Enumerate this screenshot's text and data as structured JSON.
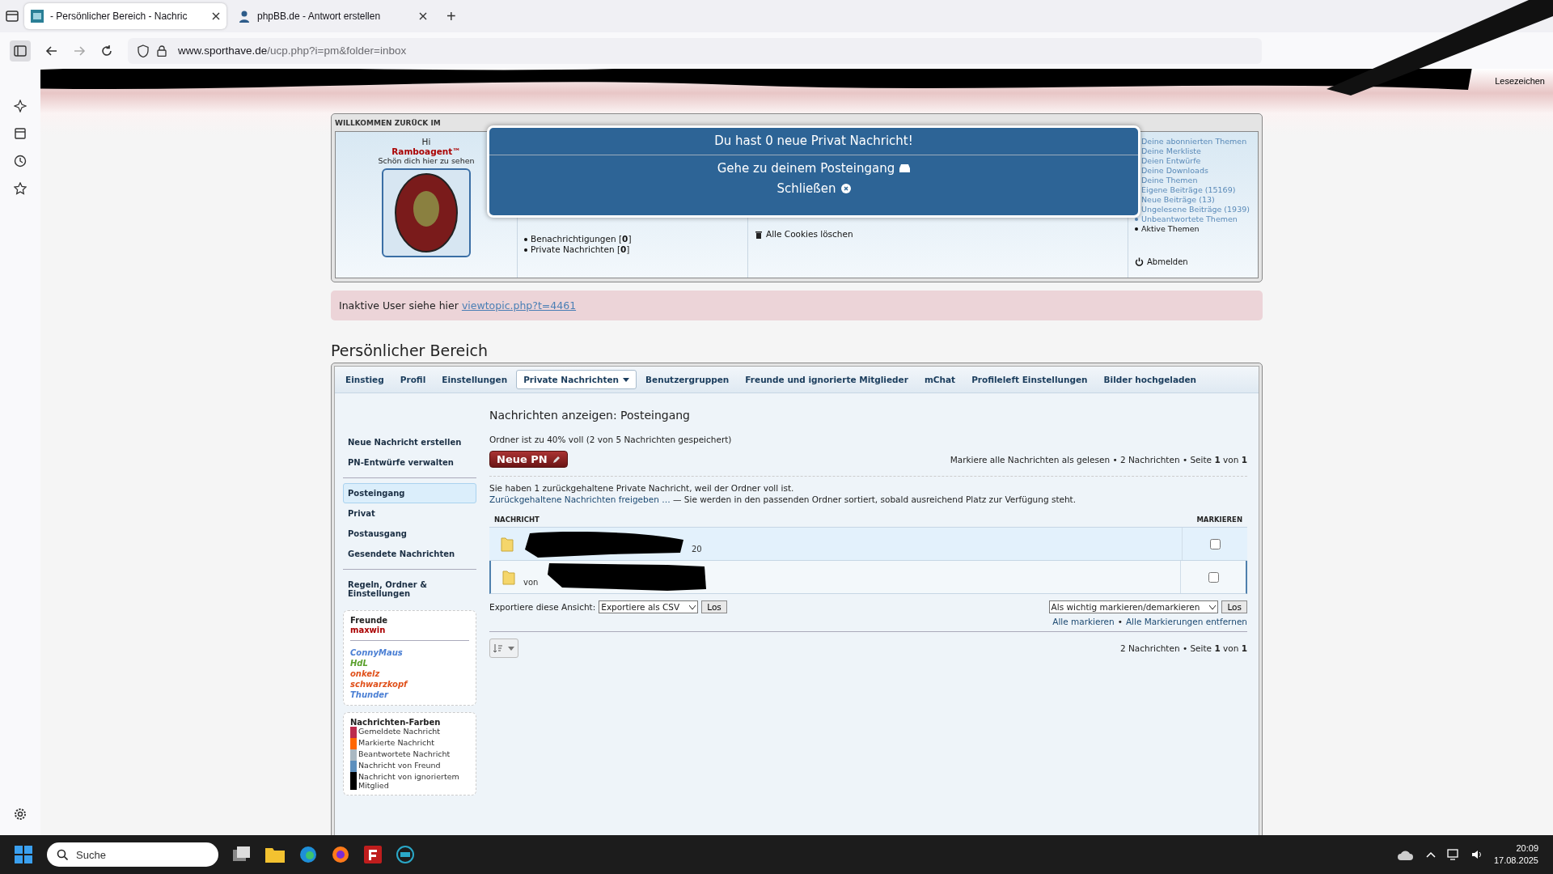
{
  "browser": {
    "tabs": [
      {
        "title": "- Persönlicher Bereich - Nachric",
        "selected": true
      },
      {
        "title": "phpBB.de - Antwort erstellen",
        "selected": false
      }
    ],
    "new_tab": "+",
    "url_host": "www.sporthave.de",
    "url_path": "/ucp.php?i=pm&folder=inbox",
    "bookmarks_label": "Lesezeichen"
  },
  "welcome": {
    "heading": "WILLKOMMEN ZURÜCK IM",
    "greeting": "Hi",
    "username": "Ramboagent™",
    "tagline": "Schön dich hier zu sehen",
    "counters": [
      "Benachrichtigungen [**0**]",
      "Private Nachrichten [**0**]"
    ],
    "cookies": "Alle Cookies löschen",
    "my_links": [
      "Deine abonnierten Themen",
      "Deine Merkliste",
      "Deien Entwürfe",
      "Deine Downloads",
      "Deine Themen",
      "Eigene Beiträge (15169)",
      "Neue Beiträge (13)",
      "Ungelesene Beiträge (1939)",
      "Unbeantwortete Themen",
      "Aktive Themen"
    ],
    "logout": "Abmelden"
  },
  "notification": {
    "message": "Du hast 0 neue Privat Nachricht!",
    "inbox_link": "Gehe zu deinem Posteingang",
    "close": "Schließen"
  },
  "notice": {
    "text": "Inaktive User siehe hier",
    "link": "viewtopic.php?t=4461"
  },
  "page_title": "Persönlicher Bereich",
  "tabs": [
    {
      "label": "Einstieg",
      "selected": false,
      "has_menu": false
    },
    {
      "label": "Profil",
      "selected": false,
      "has_menu": false
    },
    {
      "label": "Einstellungen",
      "selected": false,
      "has_menu": false
    },
    {
      "label": "Private Nachrichten",
      "selected": true,
      "has_menu": true
    },
    {
      "label": "Benutzergruppen",
      "selected": false,
      "has_menu": false
    },
    {
      "label": "Freunde und ignorierte Mitglieder",
      "selected": false,
      "has_menu": false
    },
    {
      "label": "mChat",
      "selected": false,
      "has_menu": false
    },
    {
      "label": "Profileleft Einstellungen",
      "selected": false,
      "has_menu": false
    },
    {
      "label": "Bilder hochgeladen",
      "selected": false,
      "has_menu": false
    }
  ],
  "sidebar": {
    "actions": [
      "Neue Nachricht erstellen",
      "PN-Entwürfe verwalten"
    ],
    "folders": [
      {
        "label": "Posteingang",
        "selected": true
      },
      {
        "label": "Privat",
        "selected": false
      },
      {
        "label": "Postausgang",
        "selected": false
      },
      {
        "label": "Gesendete Nachrichten",
        "selected": false
      }
    ],
    "settings": "Regeln, Ordner & Einstellungen",
    "friends": {
      "title": "Freunde",
      "online": [
        {
          "name": "maxwin",
          "color": "#aa0000"
        }
      ],
      "offline": [
        {
          "name": "ConnyMaus",
          "color": "#4a7fd4"
        },
        {
          "name": "HdL",
          "color": "#5aa02c"
        },
        {
          "name": "onkelz",
          "color": "#e0501a"
        },
        {
          "name": "schwarzkopf",
          "color": "#e0501a"
        },
        {
          "name": "Thunder",
          "color": "#4a7fd4"
        }
      ]
    },
    "legend": {
      "title": "Nachrichten-Farben",
      "items": [
        {
          "label": "Gemeldete Nachricht",
          "color": "#bc2a4d"
        },
        {
          "label": "Markierte Nachricht",
          "color": "#ff6600"
        },
        {
          "label": "Beantwortete Nachricht",
          "color": "#a9b8c2"
        },
        {
          "label": "Nachricht von Freund",
          "color": "#5d8fbd"
        },
        {
          "label": "Nachricht von ignoriertem Mitglied",
          "color": "#000000"
        }
      ]
    }
  },
  "main": {
    "title": "Nachrichten anzeigen: Posteingang",
    "folder_status": "Ordner ist zu 40% voll (2 von 5 Nachrichten gespeichert)",
    "new_button": "Neue PN",
    "summary": "Markiere alle Nachrichten als gelesen • 2 Nachrichten • Seite **1** von **1**",
    "held_notice": "Sie haben 1 zurückgehaltene Private Nachricht, weil der Ordner voll ist.",
    "release_link": "Zurückgehaltene Nachrichten freigeben …",
    "release_text": "— Sie werden in den passenden Ordner sortiert, sobald ausreichend Platz zur Verfügung steht.",
    "columns": [
      "NACHRICHT",
      "MARKIEREN"
    ],
    "rows": [
      {
        "fragment": "20",
        "highlighted": true,
        "checked": false
      },
      {
        "fragment": "von",
        "highlighted": false,
        "checked": false
      }
    ],
    "export_label": "Exportiere diese Ansicht:",
    "export_value": "Exportiere als CSV",
    "export_go": "Los",
    "action_value": "Als wichtig markieren/demarkieren",
    "action_go": "Los",
    "mark_all": "Alle markieren",
    "link_separator": "•",
    "unmark_all": "Alle Markierungen entfernen",
    "footer": "2 Nachrichten • Seite **1** von **1**"
  },
  "taskbar": {
    "search": "Suche",
    "time": "20:09",
    "date": "17.08.2025"
  }
}
